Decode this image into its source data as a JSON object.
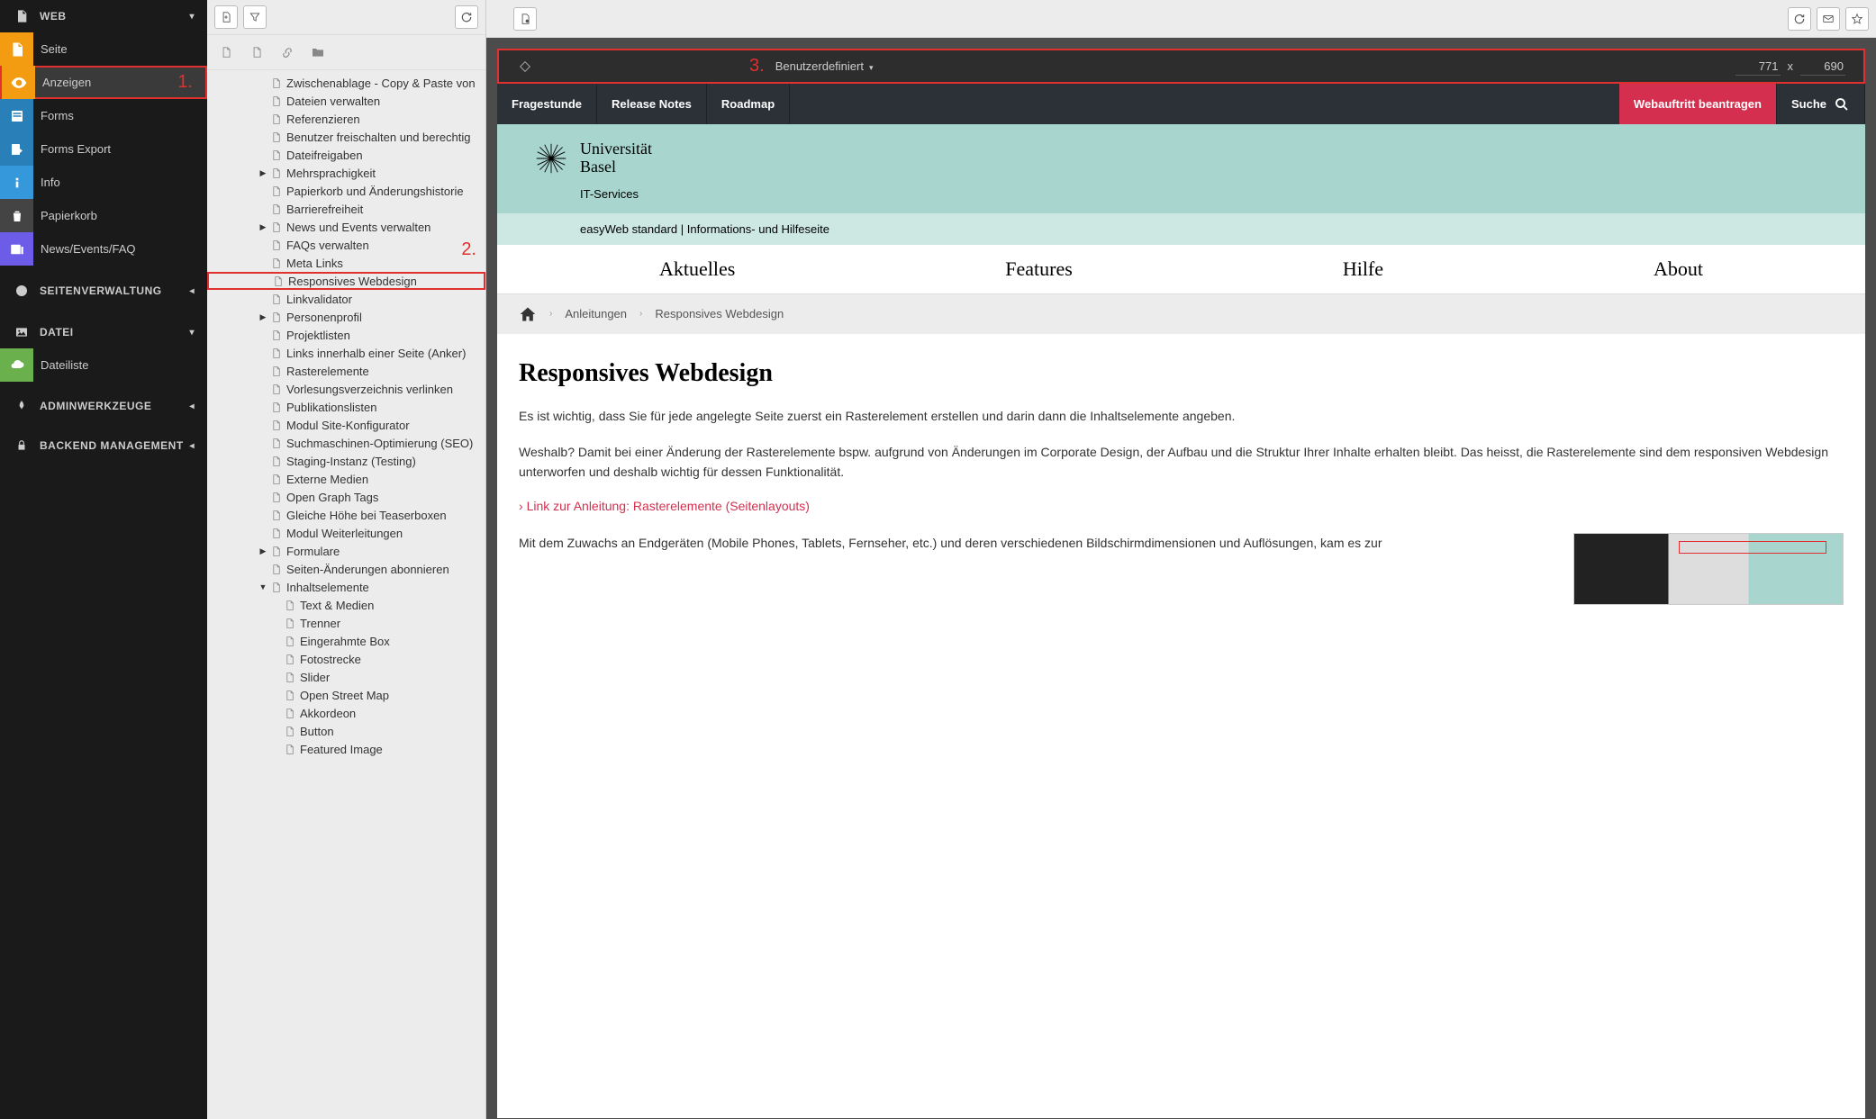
{
  "sidebar": {
    "sections": [
      {
        "title": "WEB",
        "collapsed": false,
        "items": [
          {
            "label": "Seite",
            "icon": "page-icon",
            "iconClass": "icon-orange"
          },
          {
            "label": "Anzeigen",
            "icon": "eye-icon",
            "iconClass": "icon-orange",
            "selected": true,
            "highlight": true,
            "annotation": "1."
          },
          {
            "label": "Forms",
            "icon": "form-icon",
            "iconClass": "icon-blue"
          },
          {
            "label": "Forms Export",
            "icon": "export-icon",
            "iconClass": "icon-blue"
          },
          {
            "label": "Info",
            "icon": "info-icon",
            "iconClass": "icon-lightblue"
          },
          {
            "label": "Papierkorb",
            "icon": "trash-icon",
            "iconClass": "icon-grey"
          },
          {
            "label": "News/Events/FAQ",
            "icon": "news-icon",
            "iconClass": "icon-purple"
          }
        ]
      },
      {
        "title": "SEITENVERWALTUNG",
        "collapsed": true,
        "icon": "globe-icon"
      },
      {
        "title": "DATEI",
        "collapsed": false,
        "icon": "image-icon",
        "items": [
          {
            "label": "Dateiliste",
            "icon": "cloud-icon",
            "iconClass": "icon-green"
          }
        ]
      },
      {
        "title": "ADMINWERKZEUGE",
        "collapsed": true,
        "icon": "rocket-icon"
      },
      {
        "title": "BACKEND MANAGEMENT",
        "collapsed": true,
        "icon": "lock-icon"
      }
    ]
  },
  "tree": {
    "annotation": "2.",
    "items": [
      {
        "label": "Zwischenablage - Copy & Paste von",
        "depth": 3
      },
      {
        "label": "Dateien verwalten",
        "depth": 3
      },
      {
        "label": "Referenzieren",
        "depth": 3
      },
      {
        "label": "Benutzer freischalten und berechtig",
        "depth": 3
      },
      {
        "label": "Dateifreigaben",
        "depth": 3
      },
      {
        "label": "Mehrsprachigkeit",
        "depth": 3,
        "expandable": true
      },
      {
        "label": "Papierkorb und Änderungshistorie",
        "depth": 3
      },
      {
        "label": "Barrierefreiheit",
        "depth": 3
      },
      {
        "label": "News und Events verwalten",
        "depth": 3,
        "expandable": true
      },
      {
        "label": "FAQs verwalten",
        "depth": 3
      },
      {
        "label": "Meta Links",
        "depth": 3
      },
      {
        "label": "Responsives Webdesign",
        "depth": 3,
        "selected": true
      },
      {
        "label": "Linkvalidator",
        "depth": 3
      },
      {
        "label": "Personenprofil",
        "depth": 3,
        "expandable": true
      },
      {
        "label": "Projektlisten",
        "depth": 3
      },
      {
        "label": "Links innerhalb einer Seite (Anker)",
        "depth": 3
      },
      {
        "label": "Rasterelemente",
        "depth": 3
      },
      {
        "label": "Vorlesungsverzeichnis verlinken",
        "depth": 3
      },
      {
        "label": "Publikationslisten",
        "depth": 3
      },
      {
        "label": "Modul Site-Konfigurator",
        "depth": 3
      },
      {
        "label": "Suchmaschinen-Optimierung (SEO)",
        "depth": 3
      },
      {
        "label": "Staging-Instanz (Testing)",
        "depth": 3
      },
      {
        "label": "Externe Medien",
        "depth": 3
      },
      {
        "label": "Open Graph Tags",
        "depth": 3
      },
      {
        "label": "Gleiche Höhe bei Teaserboxen",
        "depth": 3
      },
      {
        "label": "Modul Weiterleitungen",
        "depth": 3
      },
      {
        "label": "Formulare",
        "depth": 3,
        "expandable": true
      },
      {
        "label": "Seiten-Änderungen abonnieren",
        "depth": 3
      },
      {
        "label": "Inhaltselemente",
        "depth": 3,
        "expandable": true,
        "expanded": true
      },
      {
        "label": "Text & Medien",
        "depth": 4
      },
      {
        "label": "Trenner",
        "depth": 4
      },
      {
        "label": "Eingerahmte Box",
        "depth": 4
      },
      {
        "label": "Fotostrecke",
        "depth": 4
      },
      {
        "label": "Slider",
        "depth": 4
      },
      {
        "label": "Open Street Map",
        "depth": 4
      },
      {
        "label": "Akkordeon",
        "depth": 4
      },
      {
        "label": "Button",
        "depth": 4
      },
      {
        "label": "Featured Image",
        "depth": 4
      }
    ]
  },
  "viewport": {
    "annotation": "3.",
    "mode": "Benutzerdefiniert",
    "width": "771",
    "sep": "x",
    "height": "690"
  },
  "site": {
    "nav": [
      "Fragestunde",
      "Release Notes",
      "Roadmap"
    ],
    "navRed": "Webauftritt beantragen",
    "navSearch": "Suche",
    "uniLine1": "Universität",
    "uniLine2": "Basel",
    "dept": "IT-Services",
    "subheader": "easyWeb standard | Informations- und Hilfeseite",
    "mainnav": [
      "Aktuelles",
      "Features",
      "Hilfe",
      "About"
    ],
    "breadcrumb": [
      "Anleitungen",
      "Responsives Webdesign"
    ],
    "h1": "Responsives Webdesign",
    "p1": "Es ist wichtig, dass Sie für jede angelegte Seite zuerst ein Rasterelement erstellen und darin dann die Inhaltselemente angeben.",
    "p2": "Weshalb? Damit bei einer Änderung der Rasterelemente bspw. aufgrund von Änderungen im Corporate Design, der Aufbau und die Struktur Ihrer Inhalte erhalten bleibt. Das heisst, die Rasterelemente sind dem responsiven Webdesign unterworfen und deshalb wichtig für dessen Funktionalität.",
    "link1": "Link zur Anleitung: Rasterelemente (Seitenlayouts)",
    "p3": "Mit dem Zuwachs an Endgeräten (Mobile Phones, Tablets, Fernseher, etc.) und deren verschiedenen Bildschirmdimensionen und Auflösungen, kam es zur"
  }
}
